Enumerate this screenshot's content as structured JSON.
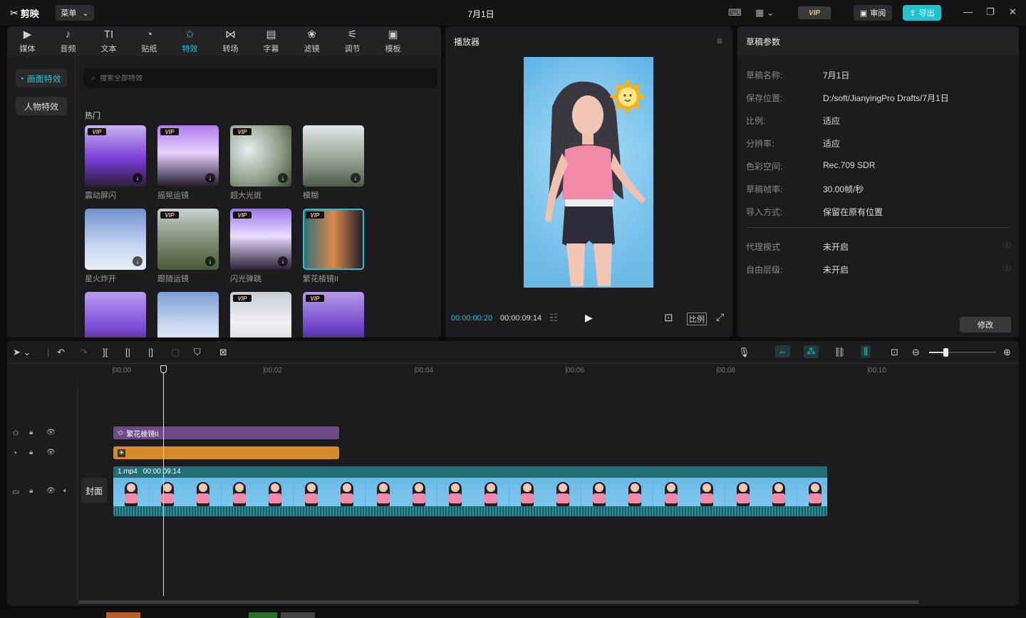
{
  "app": {
    "logo_text": "剪映",
    "menu_label": "菜单",
    "title": "7月1日"
  },
  "topbar": {
    "vip_label": "VIP",
    "review_label": "审阅",
    "export_label": "导出"
  },
  "library": {
    "tabs": [
      {
        "label": "媒体",
        "icon": "media-icon"
      },
      {
        "label": "音频",
        "icon": "audio-icon"
      },
      {
        "label": "文本",
        "icon": "text-icon"
      },
      {
        "label": "贴纸",
        "icon": "sticker-icon"
      },
      {
        "label": "特效",
        "icon": "effects-icon"
      },
      {
        "label": "转场",
        "icon": "transition-icon"
      },
      {
        "label": "字幕",
        "icon": "subtitle-icon"
      },
      {
        "label": "滤镜",
        "icon": "filter-icon"
      },
      {
        "label": "调节",
        "icon": "adjust-icon"
      },
      {
        "label": "模板",
        "icon": "template-icon"
      }
    ],
    "active_tab": "特效",
    "side": [
      {
        "label": "画面特效",
        "active": true
      },
      {
        "label": "人物特效",
        "active": false
      }
    ],
    "search_placeholder": "搜索全部特效",
    "section": "热门",
    "effects": [
      {
        "label": "震动屏闪",
        "vip": true,
        "download": true
      },
      {
        "label": "摇晃运镜",
        "vip": true,
        "download": true
      },
      {
        "label": "超大光斑",
        "vip": true,
        "download": true
      },
      {
        "label": "模糊",
        "vip": false,
        "download": true
      },
      {
        "label": "星火炸开",
        "vip": false,
        "download": true
      },
      {
        "label": "跟随运镜",
        "vip": true,
        "download": true
      },
      {
        "label": "闪光弹跳",
        "vip": true,
        "download": true
      },
      {
        "label": "繁花棱镜II",
        "vip": true,
        "download": false,
        "selected": true
      },
      {
        "label": "",
        "vip": false,
        "download": false
      },
      {
        "label": "",
        "vip": false,
        "download": false
      },
      {
        "label": "",
        "vip": true,
        "download": false
      },
      {
        "label": "",
        "vip": true,
        "download": false
      }
    ]
  },
  "player": {
    "title": "播放器",
    "current_time": "00:00:00:20",
    "total_time": "00:00:09:14",
    "ratio_label": "比例"
  },
  "properties": {
    "title": "草稿参数",
    "rows": [
      {
        "label": "草稿名称:",
        "value": "7月1日"
      },
      {
        "label": "保存位置:",
        "value": "D:/soft/JianyingPro Drafts/7月1日"
      },
      {
        "label": "比例:",
        "value": "适应"
      },
      {
        "label": "分辨率:",
        "value": "适应"
      },
      {
        "label": "色彩空间:",
        "value": "Rec.709 SDR"
      },
      {
        "label": "草稿帧率:",
        "value": "30.00帧/秒"
      },
      {
        "label": "导入方式:",
        "value": "保留在原有位置"
      }
    ],
    "rows2": [
      {
        "label": "代理模式",
        "value": "未开启"
      },
      {
        "label": "自由层级:",
        "value": "未开启"
      }
    ],
    "modify_label": "修改"
  },
  "timeline": {
    "ruler": [
      "00:00",
      "00:02",
      "00:04",
      "00:06",
      "00:08",
      "00:10"
    ],
    "effect_clip_label": "繁花棱镜II",
    "cover_label": "封面",
    "video_clip_name": "1.mp4",
    "video_clip_duration": "00:00:09:14"
  },
  "colors": {
    "accent": "#22c3cf",
    "effect_clip": "#6e4a86",
    "sticker_clip": "#d88a2a",
    "video_clip": "#1f6e78"
  }
}
